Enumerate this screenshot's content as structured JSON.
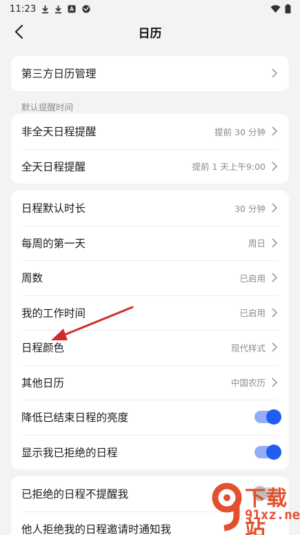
{
  "status_bar": {
    "time": "11:23",
    "left_icons": [
      "download-icon",
      "download-icon",
      "app-icon",
      "app-icon"
    ],
    "right_icons": [
      "wifi-icon",
      "battery-icon"
    ]
  },
  "header": {
    "title": "日历",
    "back_icon": "back-arrow-icon"
  },
  "card1": {
    "items": [
      {
        "label": "第三方日历管理"
      }
    ]
  },
  "section_reminder_label": "默认提醒时间",
  "card2": {
    "items": [
      {
        "label": "非全天日程提醒",
        "value": "提前 30 分钟"
      },
      {
        "label": "全天日程提醒",
        "value": "提前 1 天上午9:00"
      }
    ]
  },
  "card3": {
    "items": [
      {
        "label": "日程默认时长",
        "value": "30 分钟"
      },
      {
        "label": "每周的第一天",
        "value": "周日"
      },
      {
        "label": "周数",
        "value": "已启用"
      },
      {
        "label": "我的工作时间",
        "value": "已启用"
      },
      {
        "label": "日程颜色",
        "value": "现代样式"
      },
      {
        "label": "其他日历",
        "value": "中国农历"
      },
      {
        "label": "降低已结束日程的亮度",
        "toggle": true
      },
      {
        "label": "显示我已拒绝的日程",
        "toggle": true
      }
    ]
  },
  "card4": {
    "items": [
      {
        "label": "已拒绝的日程不提醒我",
        "toggle": false
      },
      {
        "label": "他人拒绝我的日程邀请时通知我"
      }
    ]
  },
  "colors": {
    "accent": "#1f5ef0",
    "annotation_arrow": "#d22b2b",
    "watermark": "#e2502f"
  },
  "watermark": {
    "line1": "下载站",
    "line2": "91xz.net"
  }
}
